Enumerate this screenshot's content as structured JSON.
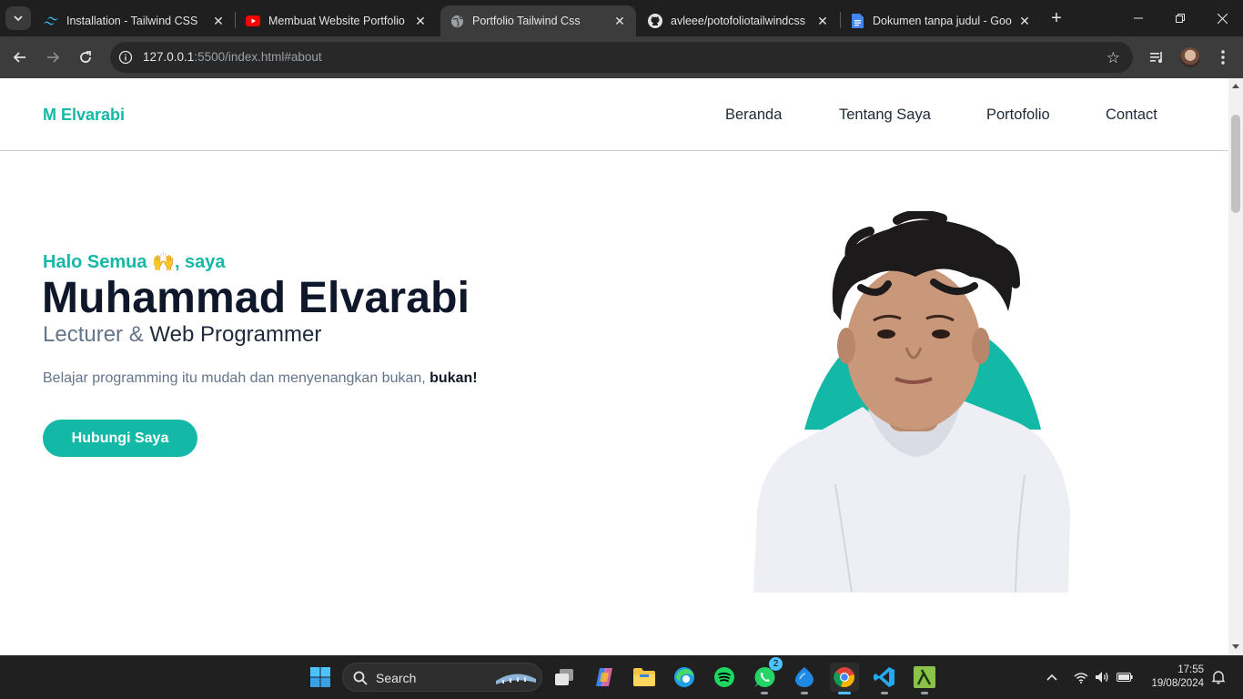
{
  "browser": {
    "tabs": [
      {
        "title": "Installation - Tailwind CSS",
        "icon": "tailwind-icon",
        "active": false
      },
      {
        "title": "Membuat Website Portfolio Dengan Tailwind",
        "icon": "youtube-icon",
        "active": false
      },
      {
        "title": "Portfolio Tailwind Css",
        "icon": "globe-icon",
        "active": true
      },
      {
        "title": "avleee/potofoliotailwindcss",
        "icon": "github-icon",
        "active": false
      },
      {
        "title": "Dokumen tanpa judul - Google Dokumen",
        "icon": "google-docs-icon",
        "active": false
      }
    ],
    "url_host": "127.0.0.1",
    "url_rest": ":5500/index.html#about"
  },
  "site": {
    "brand": "M Elvarabi",
    "nav": [
      "Beranda",
      "Tentang Saya",
      "Portofolio",
      "Contact"
    ]
  },
  "hero": {
    "greeting": "Halo Semua 🙌, saya",
    "name": "Muhammad Elvarabi",
    "role_prefix": "Lecturer & ",
    "role_main": "Web Programmer",
    "desc_text": "Belajar programming itu mudah dan menyenangkan bukan, ",
    "desc_bold": "bukan!",
    "cta": "Hubungi Saya"
  },
  "colors": {
    "accent": "#14b8a6",
    "heading": "#0f172a",
    "muted": "#64748b"
  },
  "taskbar": {
    "search_label": "Search",
    "whatsapp_badge": "2",
    "time": "17:55",
    "date": "19/08/2024"
  }
}
